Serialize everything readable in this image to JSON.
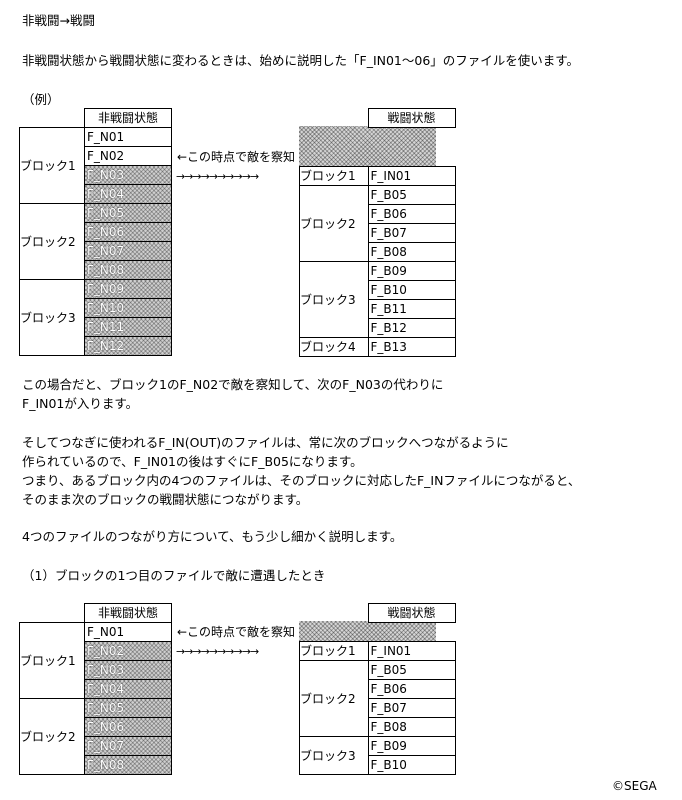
{
  "heading": "非戦闘→戦闘",
  "intro": "非戦闘状態から戦闘状態に変わるときは、始めに説明した「F_IN01～06」のファイルを使います。",
  "example_label": "（例）",
  "example1": {
    "left_header": "非戦闘状態",
    "right_header": "戦闘状態",
    "note": "←この時点で敵を察知",
    "arrow": "→→→→→→→→→→",
    "left_blocks": [
      {
        "label": "ブロック1",
        "cells": [
          "F_N01",
          "F_N02",
          "F_N03",
          "F_N04"
        ]
      },
      {
        "label": "ブロック2",
        "cells": [
          "F_N05",
          "F_N06",
          "F_N07",
          "F_N08"
        ]
      },
      {
        "label": "ブロック3",
        "cells": [
          "F_N09",
          "F_N10",
          "F_N11",
          "F_N12"
        ]
      }
    ],
    "right_blocks": [
      {
        "label": "ブロック1",
        "cells": [
          "F_IN01"
        ]
      },
      {
        "label": "ブロック2",
        "cells": [
          "F_B05",
          "F_B06",
          "F_B07",
          "F_B08"
        ]
      },
      {
        "label": "ブロック3",
        "cells": [
          "F_B09",
          "F_B10",
          "F_B11",
          "F_B12"
        ]
      },
      {
        "label": "ブロック4",
        "cells": [
          "F_B13"
        ]
      }
    ]
  },
  "para1_line1": "この場合だと、ブロック1のF_N02で敵を察知して、次のF_N03の代わりに",
  "para1_line2": "F_IN01が入ります。",
  "para2_line1": "そしてつなぎに使われるF_IN(OUT)のファイルは、常に次のブロックへつながるように",
  "para2_line2": "作られているので、F_IN01の後はすぐにF_B05になります。",
  "para2_line3": "つまり、あるブロック内の4つのファイルは、そのブロックに対応したF_INファイルにつながると、",
  "para2_line4": "そのまま次のブロックの戦闘状態につながります。",
  "para3": "4つのファイルのつながり方について、もう少し細かく説明します。",
  "section1": "（1）ブロックの1つ目のファイルで敵に遭遇したとき",
  "example2": {
    "left_header": "非戦闘状態",
    "right_header": "戦闘状態",
    "note": "←この時点で敵を察知",
    "arrow": "→→→→→→→→→→",
    "left_blocks": [
      {
        "label": "ブロック1",
        "cells": [
          "F_N01",
          "F_N02",
          "F_N03",
          "F_N04"
        ]
      },
      {
        "label": "ブロック2",
        "cells": [
          "F_N05",
          "F_N06",
          "F_N07",
          "F_N08"
        ]
      }
    ],
    "right_blocks": [
      {
        "label": "ブロック1",
        "cells": [
          "F_IN01"
        ]
      },
      {
        "label": "ブロック2",
        "cells": [
          "F_B05",
          "F_B06",
          "F_B07",
          "F_B08"
        ]
      },
      {
        "label": "ブロック3",
        "cells": [
          "F_B09",
          "F_B10"
        ]
      }
    ]
  },
  "copyright": "©SEGA"
}
